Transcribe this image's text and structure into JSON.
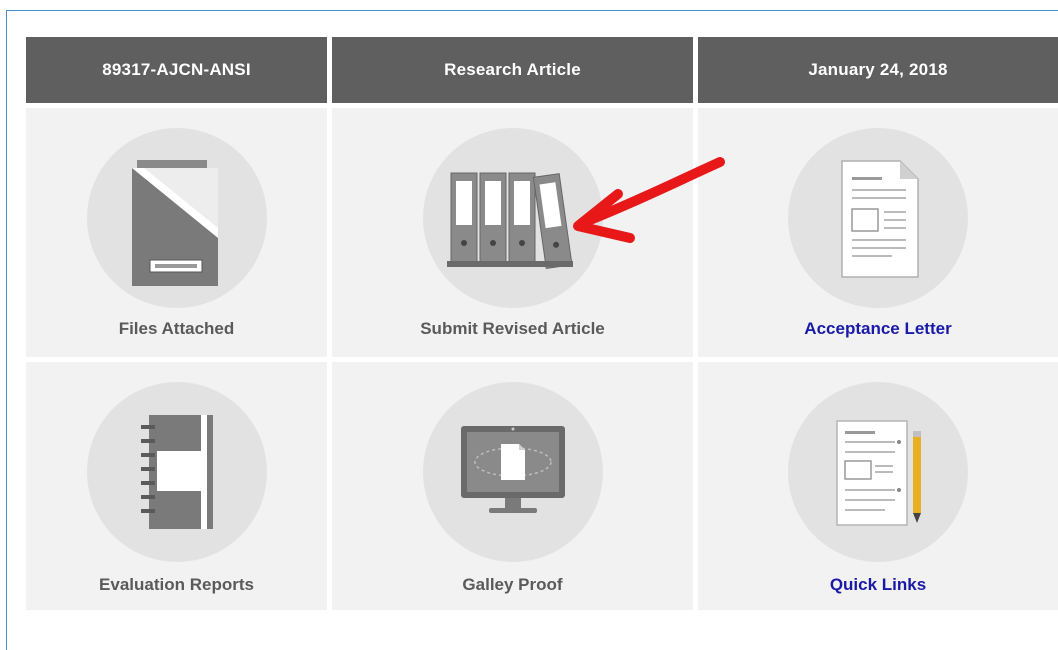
{
  "header": {
    "manuscript_id": "89317-AJCN-ANSI",
    "article_type": "Research Article",
    "date": "January 24, 2018"
  },
  "tiles": {
    "files_attached": {
      "label": "Files Attached",
      "icon": "folder-icon"
    },
    "submit_revised_article": {
      "label": "Submit Revised Article",
      "icon": "binders-icon"
    },
    "acceptance_letter": {
      "label": "Acceptance Letter",
      "icon": "document-icon"
    },
    "evaluation_reports": {
      "label": "Evaluation Reports",
      "icon": "notebook-icon"
    },
    "galley_proof": {
      "label": "Galley Proof",
      "icon": "monitor-icon"
    },
    "quick_links": {
      "label": "Quick Links",
      "icon": "checklist-pencil-icon"
    }
  },
  "colors": {
    "header_bg": "#5f5f5f",
    "tile_bg": "#f2f2f2",
    "link_text": "#1a1aa8",
    "annotation_arrow": "#e81818"
  }
}
